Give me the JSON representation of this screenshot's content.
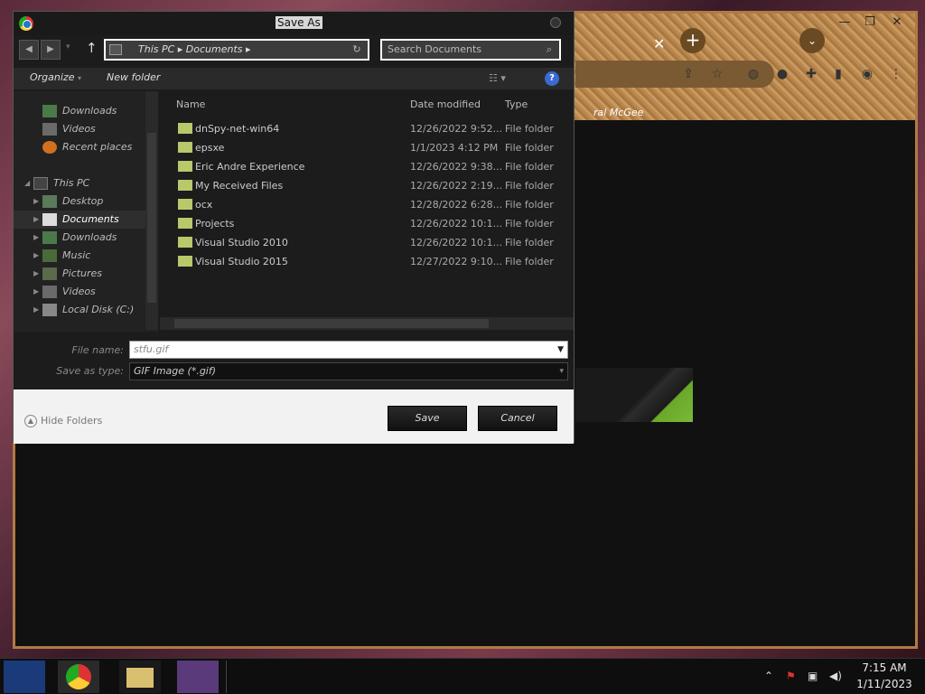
{
  "dialog": {
    "title": "Save As",
    "address": {
      "segments": [
        "This PC",
        "Documents"
      ],
      "path_text": "This PC  ▸  Documents  ▸"
    },
    "search_placeholder": "Search Documents",
    "toolbar": {
      "organize": "Organize",
      "new_folder": "New folder"
    },
    "nav": {
      "items": [
        {
          "label": "Downloads"
        },
        {
          "label": "Videos"
        },
        {
          "label": "Recent places"
        },
        {
          "label": "This PC"
        },
        {
          "label": "Desktop"
        },
        {
          "label": "Documents"
        },
        {
          "label": "Downloads"
        },
        {
          "label": "Music"
        },
        {
          "label": "Pictures"
        },
        {
          "label": "Videos"
        },
        {
          "label": "Local Disk (C:)"
        }
      ]
    },
    "columns": {
      "name": "Name",
      "date": "Date modified",
      "type": "Type"
    },
    "files": [
      {
        "name": "dnSpy-net-win64",
        "date": "12/26/2022 9:52...",
        "type": "File folder"
      },
      {
        "name": "epsxe",
        "date": "1/1/2023 4:12 PM",
        "type": "File folder"
      },
      {
        "name": "Eric Andre Experience",
        "date": "12/26/2022 9:38...",
        "type": "File folder"
      },
      {
        "name": "My Received Files",
        "date": "12/26/2022 2:19...",
        "type": "File folder"
      },
      {
        "name": "ocx",
        "date": "12/28/2022 6:28...",
        "type": "File folder"
      },
      {
        "name": "Projects",
        "date": "12/26/2022 10:1...",
        "type": "File folder"
      },
      {
        "name": "Visual Studio 2010",
        "date": "12/26/2022 10:1...",
        "type": "File folder"
      },
      {
        "name": "Visual Studio 2015",
        "date": "12/27/2022 9:10...",
        "type": "File folder"
      }
    ],
    "file_name_label": "File name:",
    "file_name_value": "stfu.gif",
    "save_type_label": "Save as type:",
    "save_type_value": "GIF Image (*.gif)",
    "hide_folders": "Hide Folders",
    "save": "Save",
    "cancel": "Cancel"
  },
  "browser": {
    "bookmark_text": "ral McGee"
  },
  "taskbar": {
    "time": "7:15 AM",
    "date": "1/11/2023"
  },
  "colors": {
    "folder": "#b8c86a",
    "accent": "#3a6ad4",
    "chrome_frame": "#b07a45"
  }
}
